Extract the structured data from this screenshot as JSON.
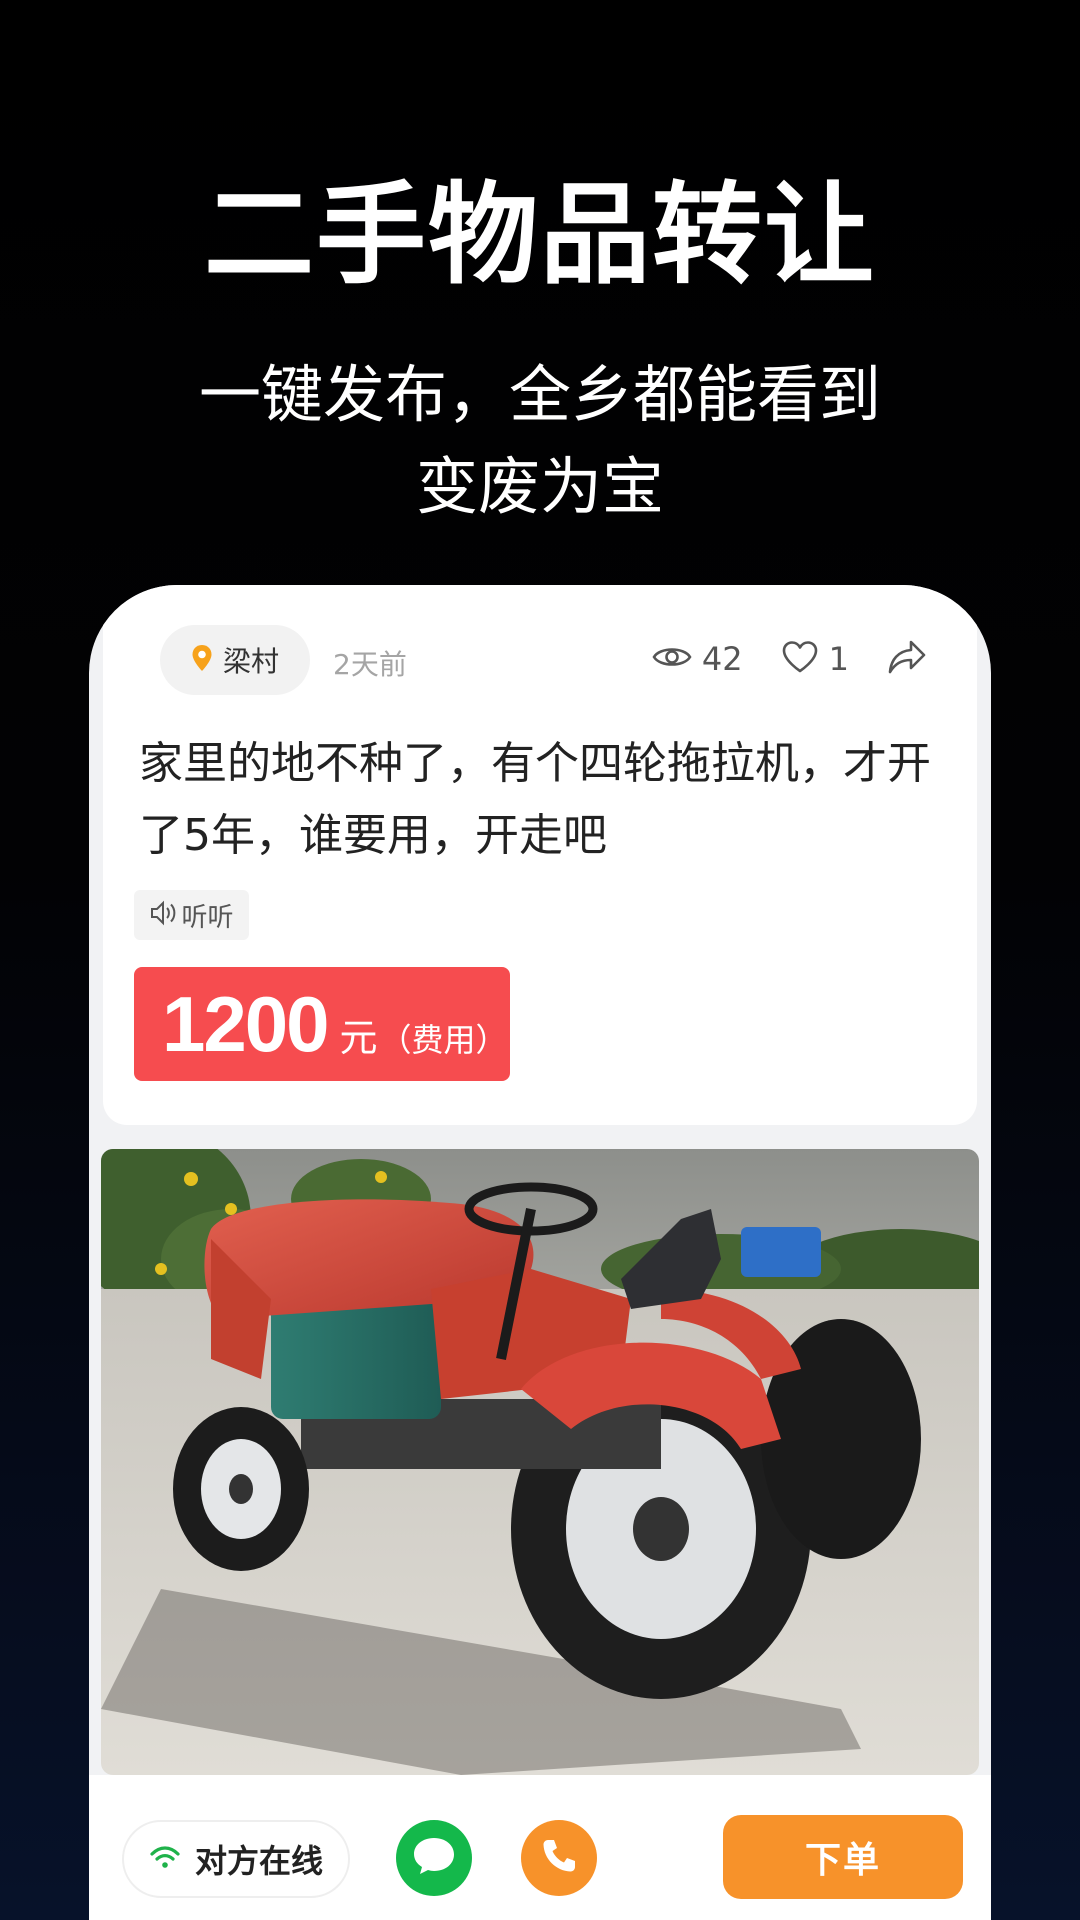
{
  "promo": {
    "title": "二手物品转让",
    "subtitle_line1": "一键发布，全乡都能看到",
    "subtitle_line2": "变废为宝"
  },
  "post": {
    "location": "梁村",
    "location_icon": "map-pin-icon",
    "time_ago": "2天前",
    "views": "42",
    "likes": "1",
    "description": "家里的地不种了，有个四轮拖拉机，才开了5年，谁要用，开走吧",
    "listen_label": "听听",
    "price": {
      "value": "1200",
      "unit": "元",
      "note": "（费用）"
    },
    "photo_subject": "red-four-wheel-tractor"
  },
  "actions": {
    "online_status": "对方在线",
    "order_label": "下单"
  },
  "colors": {
    "price_red": "#f64c4f",
    "order_orange": "#f7922a",
    "chat_green": "#14b84b",
    "call_orange": "#f7922a",
    "online_green": "#1fb24a",
    "location_orange": "#f7a21b"
  }
}
